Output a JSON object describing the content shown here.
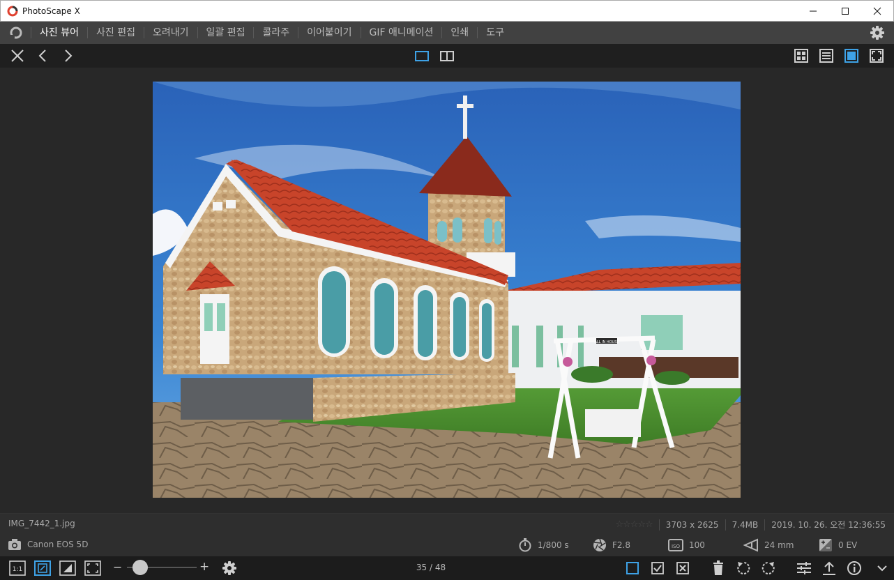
{
  "window": {
    "title": "PhotoScape X"
  },
  "menu": {
    "items": [
      {
        "label": "사진 뷰어",
        "active": true
      },
      {
        "label": "사진 편집",
        "active": false
      },
      {
        "label": "오려내기",
        "active": false
      },
      {
        "label": "일괄 편집",
        "active": false
      },
      {
        "label": "콜라주",
        "active": false
      },
      {
        "label": "이어붙이기",
        "active": false
      },
      {
        "label": "GIF 애니메이션",
        "active": false
      },
      {
        "label": "인쇄",
        "active": false
      },
      {
        "label": "도구",
        "active": false
      }
    ]
  },
  "file": {
    "name": "IMG_7442_1.jpg",
    "rating_stars": "☆☆☆☆☆",
    "dimensions": "3703 x 2625",
    "size": "7.4MB",
    "date": "2019. 10. 26. 오전 12:36:55"
  },
  "exif": {
    "camera": "Canon EOS 5D",
    "shutter": "1/800 s",
    "aperture": "F2.8",
    "iso": "100",
    "focal": "24 mm",
    "ev": "0 EV"
  },
  "bottom": {
    "page": "35 / 48",
    "zoom_minus": "−",
    "zoom_plus": "+",
    "zoom_fraction": 0.15,
    "one_to_one": "1:1"
  },
  "photo_sign_text": "ALL IN HOUSE",
  "colors": {
    "accent": "#3ea2e6",
    "background": "#282828",
    "menubar": "#414141"
  }
}
